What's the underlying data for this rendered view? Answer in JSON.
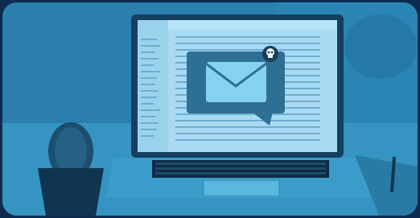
{
  "scene": {
    "description_tags": [
      "laptop",
      "email-icon",
      "skull-icon",
      "cactus",
      "notebook",
      "pen"
    ],
    "palette": {
      "frame": "#0d2c4d",
      "tint": "#2b87b6",
      "screen": "#a9ddf4",
      "bubble": "#2d6f95",
      "envelope": "#83d0ee"
    }
  }
}
